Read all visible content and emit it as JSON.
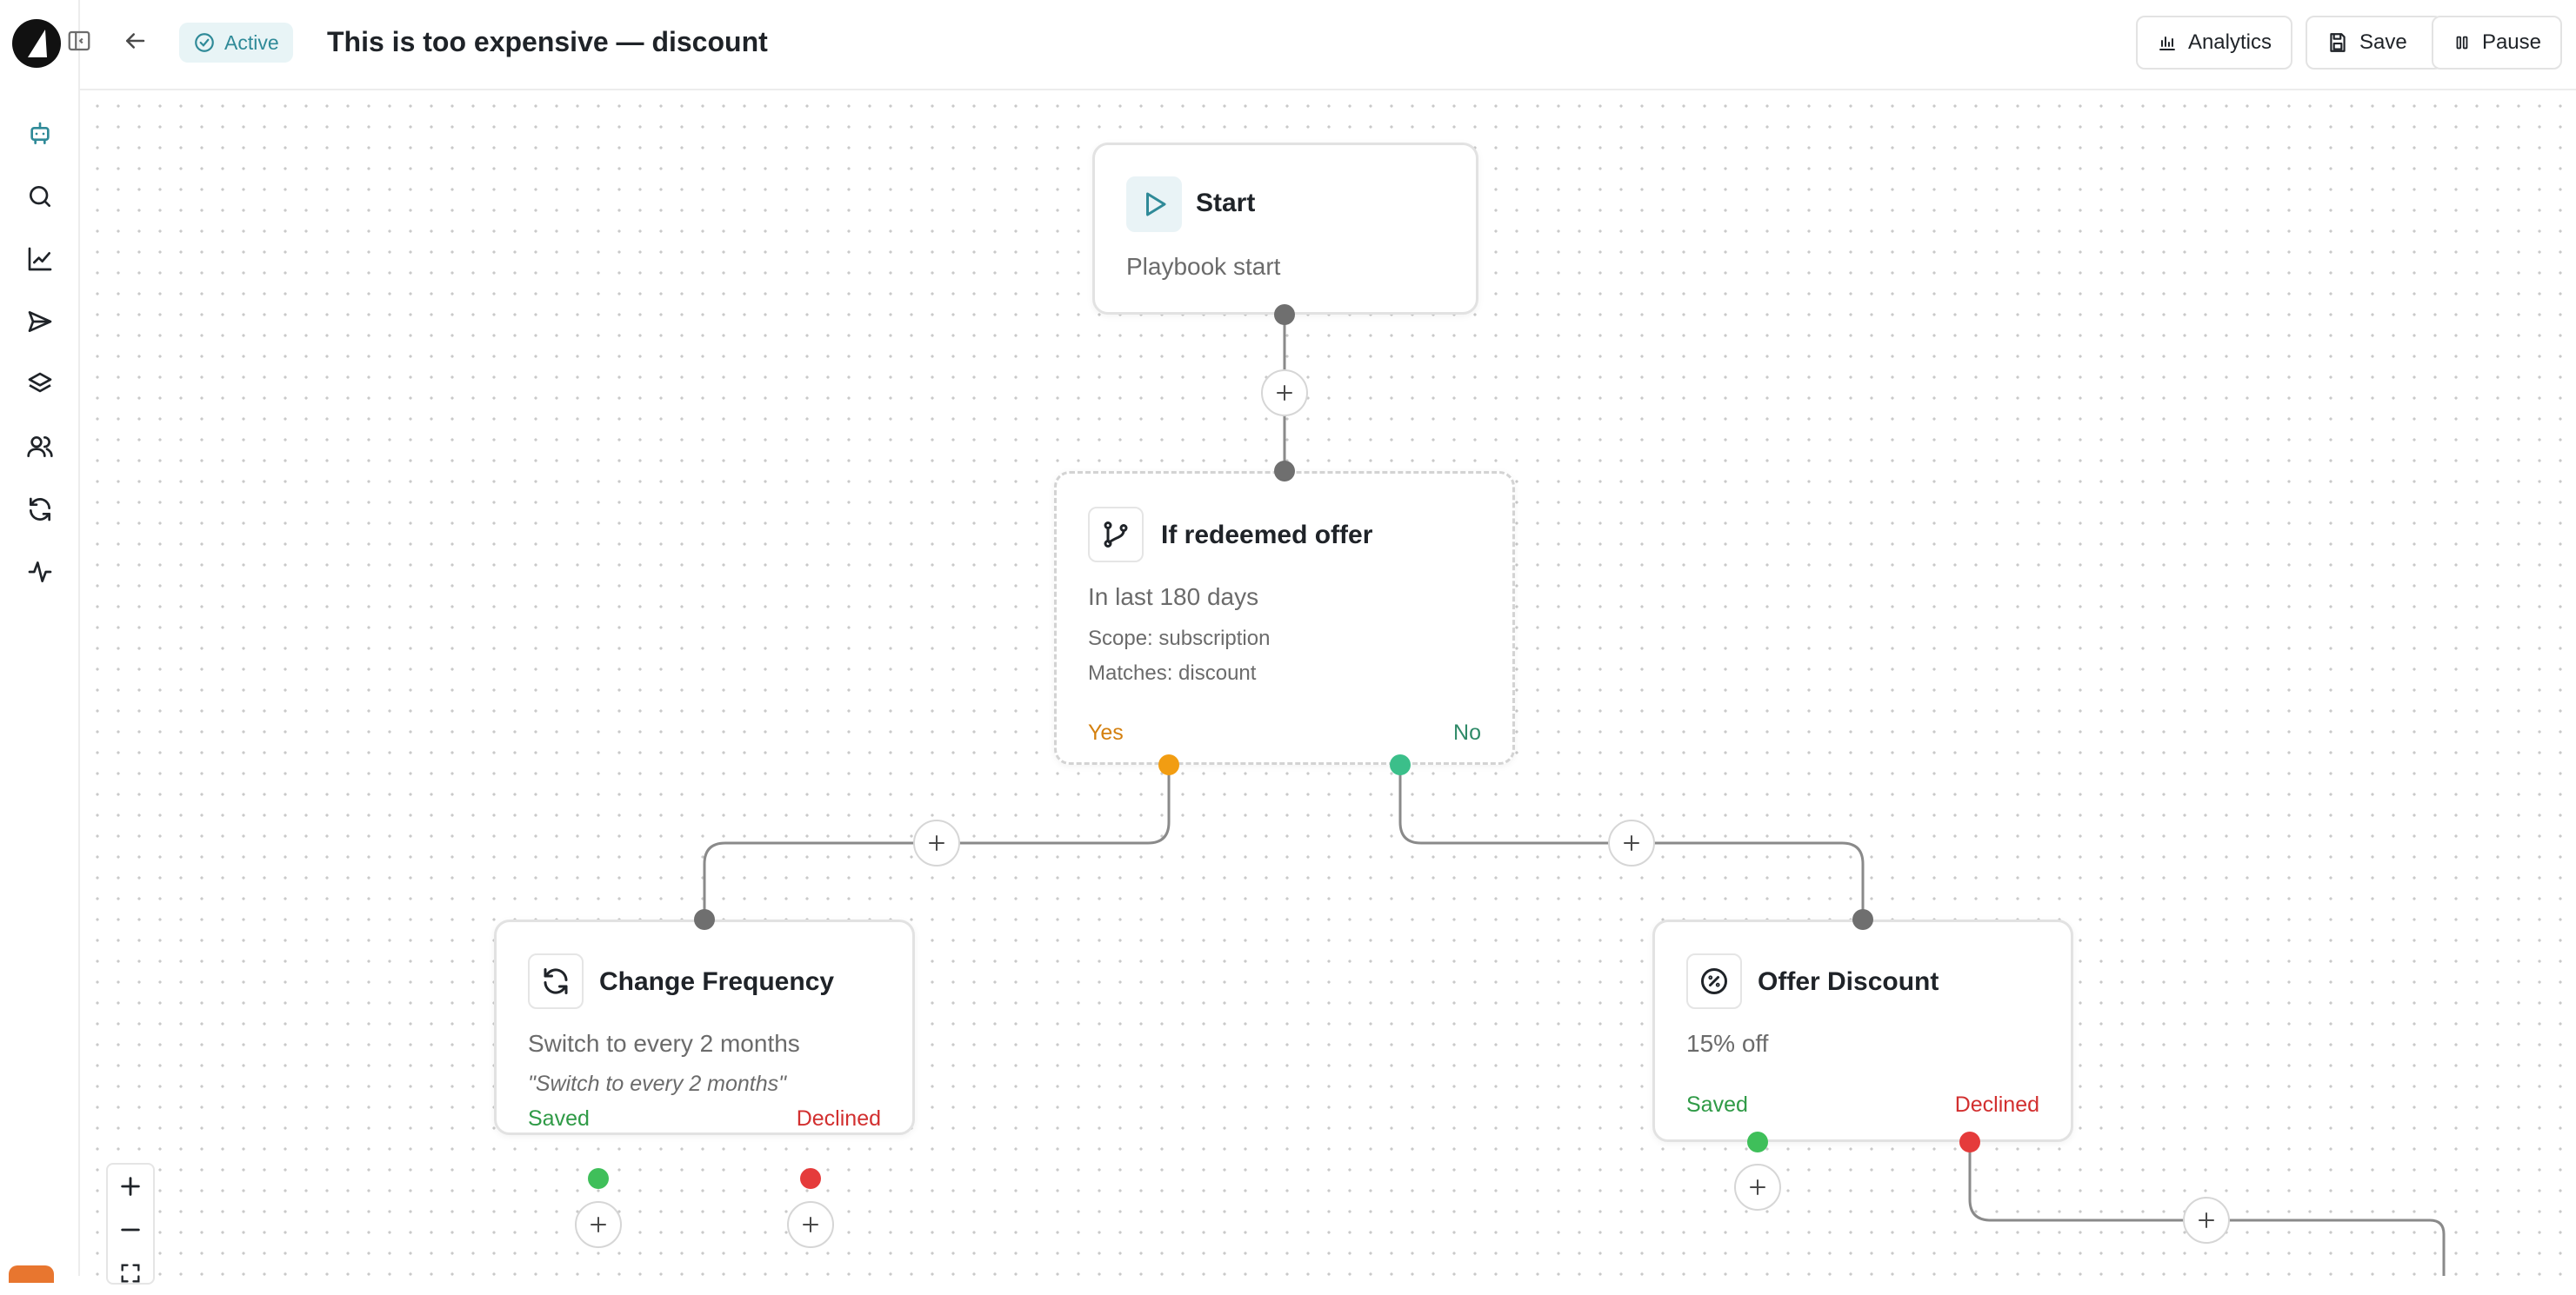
{
  "header": {
    "status": "Active",
    "title": "This is too expensive — discount",
    "actions": {
      "analytics": "Analytics",
      "save": "Save",
      "pause": "Pause"
    }
  },
  "flow": {
    "start": {
      "title": "Start",
      "subtitle": "Playbook start"
    },
    "condition": {
      "title": "If redeemed offer",
      "subtitle": "In last 180 days",
      "scope": "Scope: subscription",
      "matches": "Matches: discount",
      "yes": "Yes",
      "no": "No"
    },
    "change_frequency": {
      "title": "Change Frequency",
      "subtitle": "Switch to every 2 months",
      "quote": "\"Switch to every 2 months\"",
      "saved": "Saved",
      "declined": "Declined"
    },
    "offer_discount": {
      "title": "Offer Discount",
      "subtitle": "15% off",
      "saved": "Saved",
      "declined": "Declined"
    }
  },
  "colors": {
    "accent": "#2f8a98",
    "yes": "#f29d12",
    "no": "#3bbf8a",
    "saved": "#3fbf5a",
    "declined": "#e53b3b"
  },
  "icons": {
    "sidebar": [
      "bot-icon",
      "search-icon",
      "chart-line-icon",
      "send-icon",
      "layers-icon",
      "users-icon",
      "refresh-icon",
      "activity-icon"
    ]
  }
}
